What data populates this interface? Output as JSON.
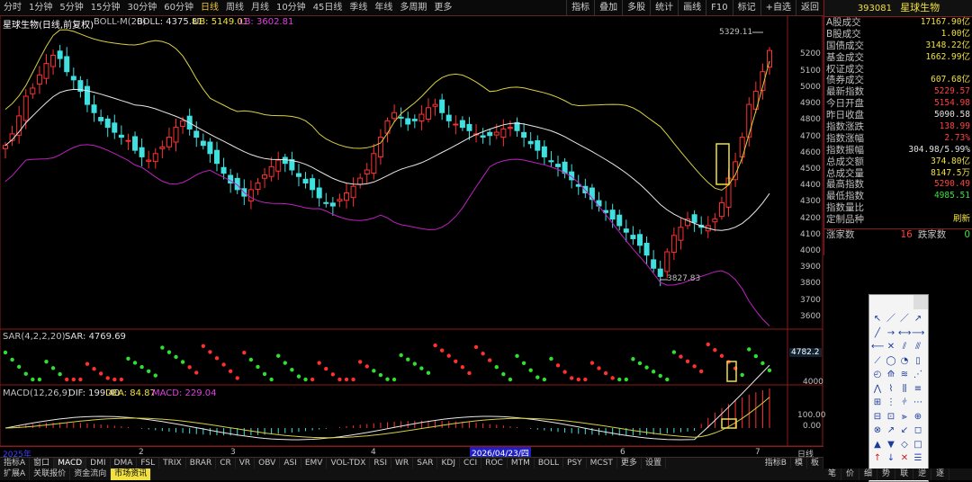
{
  "toolbar": {
    "periods": [
      "分时",
      "1分钟",
      "5分钟",
      "15分钟",
      "30分钟",
      "60分钟",
      "日线",
      "周线",
      "月线",
      "10分钟",
      "45日线",
      "季线",
      "年线",
      "多周期",
      "更多"
    ],
    "active_period": "日线",
    "right_buttons": [
      "指标",
      "叠加",
      "多股",
      "统计",
      "画线",
      "F10",
      "标记",
      "+自选",
      "返回"
    ]
  },
  "main_chart": {
    "title": "星球生物(日线,前复权)",
    "indicator": "BOLL-M(20)",
    "boll_label": "BOLL: 4375.81",
    "ub_label": "UB: 5149.01",
    "lb_label": "LB: 3602.81",
    "high_marker": "5329.11",
    "low_marker": "3827.83",
    "y_ticks": [
      "5200",
      "5100",
      "5000",
      "4900",
      "4800",
      "4700",
      "4600",
      "4500",
      "4400",
      "4300",
      "4200",
      "4100",
      "4000",
      "3900",
      "3800",
      "3700",
      "3600"
    ]
  },
  "sar_panel": {
    "title": "SAR(4,2,2,20)",
    "value_label": "SAR: 4769.69",
    "current_tag": "4782.2",
    "y_tick": "4000"
  },
  "macd_panel": {
    "title": "MACD(12,26,9)",
    "dif": "DIF: 199.40",
    "dea": "DEA: 84.87",
    "macd": "MACD: 229.04",
    "y_ticks": [
      "100.00",
      "0.00"
    ]
  },
  "x_axis": {
    "labels": [
      "2025年",
      "2",
      "3",
      "4",
      "2026/04/23/四",
      "6",
      "7"
    ],
    "right_label": "日线"
  },
  "indicator_tabs": [
    "指标A",
    "窗口",
    "MACD",
    "DMI",
    "DMA",
    "FSL",
    "TRIX",
    "BRAR",
    "CR",
    "VR",
    "OBV",
    "ASI",
    "EMV",
    "VOL-TDX",
    "RSI",
    "WR",
    "SAR",
    "KDJ",
    "CCI",
    "ROC",
    "MTM",
    "BOLL",
    "PSY",
    "MCST",
    "更多",
    "设置"
  ],
  "indicator_right": [
    "指标B",
    "模",
    "板"
  ],
  "bottom_tabs": [
    "扩展A",
    "关联报价",
    "资金流向",
    "市场资讯"
  ],
  "quote_panel": {
    "code": "393081",
    "name": "星球生物",
    "rows": [
      {
        "k": "A股成交",
        "v": "17167.90亿",
        "c": "yel"
      },
      {
        "k": "B股成交",
        "v": "1.00亿",
        "c": "yel"
      },
      {
        "k": "国债成交",
        "v": "3148.22亿",
        "c": "yel"
      },
      {
        "k": "基金成交",
        "v": "1662.99亿",
        "c": "yel"
      },
      {
        "k": "权证成交",
        "v": "",
        "c": "yel"
      },
      {
        "k": "债券成交",
        "v": "607.68亿",
        "c": "yel"
      },
      {
        "k": "最新指数",
        "v": "5229.57",
        "c": "up"
      },
      {
        "k": "今日开盘",
        "v": "5154.98",
        "c": "up"
      },
      {
        "k": "昨日收盘",
        "v": "5090.58",
        "c": "wht"
      },
      {
        "k": "指数涨跌",
        "v": "138.99",
        "c": "up"
      },
      {
        "k": "指数涨幅",
        "v": "2.73%",
        "c": "up"
      },
      {
        "k": "指数振幅",
        "v": "304.98/5.99%",
        "c": "wht"
      },
      {
        "k": "总成交额",
        "v": "374.80亿",
        "c": "yel"
      },
      {
        "k": "总成交量",
        "v": "8147.5万",
        "c": "yel"
      },
      {
        "k": "最高指数",
        "v": "5290.49",
        "c": "up"
      },
      {
        "k": "最低指数",
        "v": "4985.51",
        "c": "grn"
      },
      {
        "k": "指数量比",
        "v": "",
        "c": "wht"
      },
      {
        "k": "定制品种",
        "v": "刷新",
        "c": "yel"
      }
    ],
    "up_count_label": "涨家数",
    "up_count": "16",
    "down_count_label": "跌家数",
    "down_count": "0"
  },
  "bottom_right": [
    "笔",
    "价",
    "细",
    "势",
    "联",
    "逆",
    "逐"
  ],
  "chart_data": {
    "type": "candlestick",
    "title": "星球生物(日线,前复权)",
    "indicators": {
      "BOLL": 4375.81,
      "UB": 5149.01,
      "LB": 3602.81,
      "SAR": 4769.69,
      "DIF": 199.4,
      "DEA": 84.87,
      "MACD": 229.04
    },
    "ylim": [
      3550,
      5340
    ],
    "high": 5329.11,
    "low": 3827.83,
    "closes": [
      4650,
      4720,
      4830,
      4950,
      5000,
      5080,
      5150,
      5200,
      5180,
      5100,
      5050,
      4980,
      4900,
      4850,
      4800,
      4760,
      4730,
      4700,
      4680,
      4620,
      4580,
      4560,
      4600,
      4640,
      4700,
      4760,
      4800,
      4750,
      4700,
      4650,
      4600,
      4540,
      4480,
      4420,
      4380,
      4340,
      4380,
      4420,
      4470,
      4520,
      4560,
      4540,
      4500,
      4460,
      4420,
      4380,
      4330,
      4300,
      4280,
      4320,
      4360,
      4400,
      4450,
      4500,
      4600,
      4700,
      4800,
      4850,
      4820,
      4780,
      4800,
      4840,
      4880,
      4900,
      4850,
      4800,
      4780,
      4760,
      4740,
      4720,
      4700,
      4710,
      4730,
      4750,
      4760,
      4740,
      4700,
      4660,
      4620,
      4580,
      4550,
      4520,
      4480,
      4440,
      4400,
      4360,
      4320,
      4280,
      4240,
      4200,
      4160,
      4120,
      4080,
      4040,
      3980,
      3900,
      3850,
      4000,
      4100,
      4150,
      4200,
      4180,
      4150,
      4160,
      4200,
      4300,
      4450,
      4550,
      4700,
      4900,
      4980,
      5100,
      5229.57
    ]
  }
}
